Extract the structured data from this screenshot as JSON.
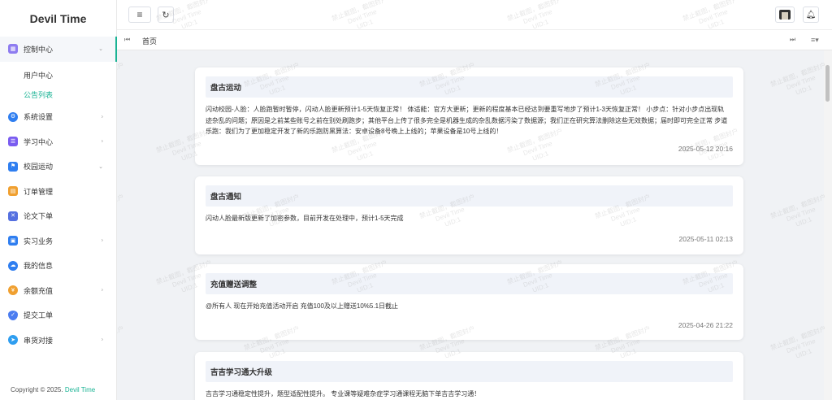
{
  "brand": "Devil Time",
  "sidebar": {
    "items": [
      {
        "label": "控制中心",
        "icon": "dashboard-icon",
        "color": "#8e7cf0",
        "chevron": "down"
      },
      {
        "label": "系统设置",
        "icon": "gear-icon",
        "color": "#2f7ef0",
        "chevron": "right"
      },
      {
        "label": "学习中心",
        "icon": "book-icon",
        "color": "#7a5cf0",
        "chevron": "right"
      },
      {
        "label": "校园运动",
        "icon": "run-icon",
        "color": "#2f7ef0",
        "chevron": "right"
      },
      {
        "label": "订单管理",
        "icon": "order-icon",
        "color": "#f0a030",
        "chevron": "right"
      },
      {
        "label": "论文下单",
        "icon": "paper-icon",
        "color": "#5570e0",
        "chevron": ""
      },
      {
        "label": "实习业务",
        "icon": "briefcase-icon",
        "color": "#2f7ef0",
        "chevron": "right"
      },
      {
        "label": "我的信息",
        "icon": "cloud-icon",
        "color": "#2f7ef0",
        "chevron": ""
      },
      {
        "label": "余额充值",
        "icon": "coin-icon",
        "color": "#f0a030",
        "chevron": "right"
      },
      {
        "label": "提交工单",
        "icon": "shield-icon",
        "color": "#4a7cf0",
        "chevron": ""
      },
      {
        "label": "串货对接",
        "icon": "send-icon",
        "color": "#2f9ef0",
        "chevron": "right"
      }
    ],
    "submenu": [
      {
        "label": "用户中心",
        "active": false
      },
      {
        "label": "公告列表",
        "active": true
      }
    ],
    "copyright_prefix": "Copyright © 2025.",
    "copyright_brand": "Devil Time"
  },
  "header": {
    "menu_toggle_icon": "hamburger-icon",
    "refresh_icon": "refresh-icon",
    "avatar_icon": "avatar-icon",
    "bell_icon": "bell-icon"
  },
  "tabs": {
    "prev_icon": "double-left-icon",
    "home_label": "首页",
    "next_icon": "double-right-icon",
    "menu_icon": "tab-menu-icon"
  },
  "announcements": [
    {
      "title": "盘古运动",
      "body": "闪动校园-人脸：人脸跑暂时暂停，闪动人脸更新预计1-5天恢复正常！ 体适能：官方大更新；更新的程度基本已经达到要重写地步了预计1-3天恢复正常！ 小步点：针对小步点出现轨迹杂乱的问题；原因是之前某些账号之前在别处刷跑步；其他平台上传了很多完全是机器生成的杂乱数据污染了数据源；我们正在研究算法删除这些无效数据；届时即可完全正常 步道乐跑：我们为了更加稳定开发了新的乐跑防黑算法：安卓设备8号晚上上线的；苹果设备是10号上线的！",
      "date": "2025-05-12 20:16"
    },
    {
      "title": "盘古通知",
      "body": "闪动人脸最新版更新了加密参数，目前开发在处理中，预计1-5天完成",
      "date": "2025-05-11 02:13"
    },
    {
      "title": "充值赠送调整",
      "body": "@所有人 现在开始充值活动开启 充值100及以上赠送10%5.1日截止",
      "date": "2025-04-26 21:22"
    },
    {
      "title": "吉吉学习通大升级",
      "body": "吉吉学习通稳定性提升，题型适配性提升。 专业课等疑难杂症学习通课程无脑下单吉吉学习通！",
      "date": ""
    }
  ],
  "watermark": {
    "line1": "禁止截图，截图封户",
    "line2": "Devil Time",
    "line3": "UID:1"
  }
}
